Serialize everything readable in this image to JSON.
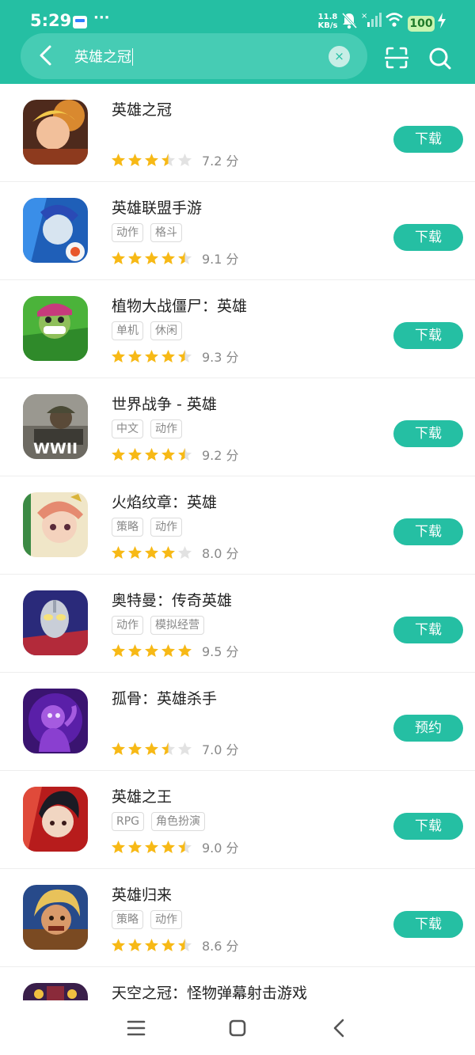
{
  "status_bar": {
    "time": "5:29",
    "more": "···",
    "net_speed_value": "11.8",
    "net_speed_unit": "KB/s",
    "battery": "100"
  },
  "search": {
    "query": "英雄之冠",
    "clear_icon": "×"
  },
  "icons": {
    "back": "chevron-left-icon",
    "scan": "scan-icon",
    "search": "search-icon"
  },
  "colors": {
    "brand": "#25bfa3",
    "star_filled": "#f7b916",
    "star_empty": "#e2e2e2"
  },
  "apps": [
    {
      "name": "英雄之冠",
      "tags": [],
      "stars": 3.5,
      "score": "7.2 分",
      "button": "下载"
    },
    {
      "name": "英雄联盟手游",
      "tags": [
        "动作",
        "格斗"
      ],
      "stars": 4.5,
      "score": "9.1 分",
      "button": "下载"
    },
    {
      "name": "植物大战僵尸：英雄",
      "tags": [
        "单机",
        "休闲"
      ],
      "stars": 4.5,
      "score": "9.3 分",
      "button": "下载"
    },
    {
      "name": "世界战争 - 英雄",
      "tags": [
        "中文",
        "动作"
      ],
      "stars": 4.5,
      "score": "9.2 分",
      "button": "下载",
      "icon_text": "WWII"
    },
    {
      "name": "火焰纹章：英雄",
      "tags": [
        "策略",
        "动作"
      ],
      "stars": 4,
      "score": "8.0 分",
      "button": "下载"
    },
    {
      "name": "奥特曼：传奇英雄",
      "tags": [
        "动作",
        "模拟经营"
      ],
      "stars": 5,
      "score": "9.5 分",
      "button": "下载"
    },
    {
      "name": "孤骨：英雄杀手",
      "tags": [],
      "stars": 3.5,
      "score": "7.0 分",
      "button": "预约"
    },
    {
      "name": "英雄之王",
      "tags": [
        "RPG",
        "角色扮演"
      ],
      "stars": 4.5,
      "score": "9.0 分",
      "button": "下载"
    },
    {
      "name": "英雄归来",
      "tags": [
        "策略",
        "动作"
      ],
      "stars": 4.5,
      "score": "8.6 分",
      "button": "下载"
    },
    {
      "name": "天空之冠：怪物弹幕射击游戏",
      "tags": [],
      "stars": 0,
      "score": "",
      "button": ""
    }
  ]
}
